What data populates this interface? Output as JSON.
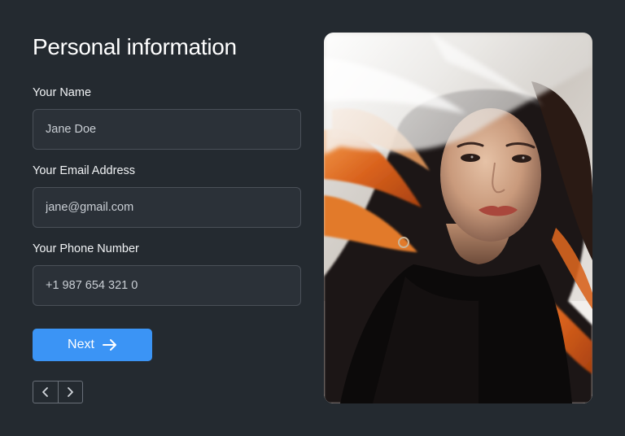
{
  "form": {
    "title": "Personal information",
    "fields": [
      {
        "label": "Your Name",
        "placeholder": "Jane Doe"
      },
      {
        "label": "Your Email Address",
        "placeholder": "jane@gmail.com"
      },
      {
        "label": "Your Phone Number",
        "placeholder": "+1 987 654 321 0"
      }
    ],
    "next_label": "Next"
  },
  "icons": {
    "next_button": "arrow-right-icon",
    "prev_page": "chevron-left-icon",
    "next_page": "chevron-right-icon"
  },
  "colors": {
    "background": "#242a30",
    "input_background": "#2b3138",
    "input_border": "#4a5058",
    "accent": "#3b94f5"
  },
  "image": {
    "subject": "portrait of a woman with dark and orange hair, white fabric blowing across"
  }
}
